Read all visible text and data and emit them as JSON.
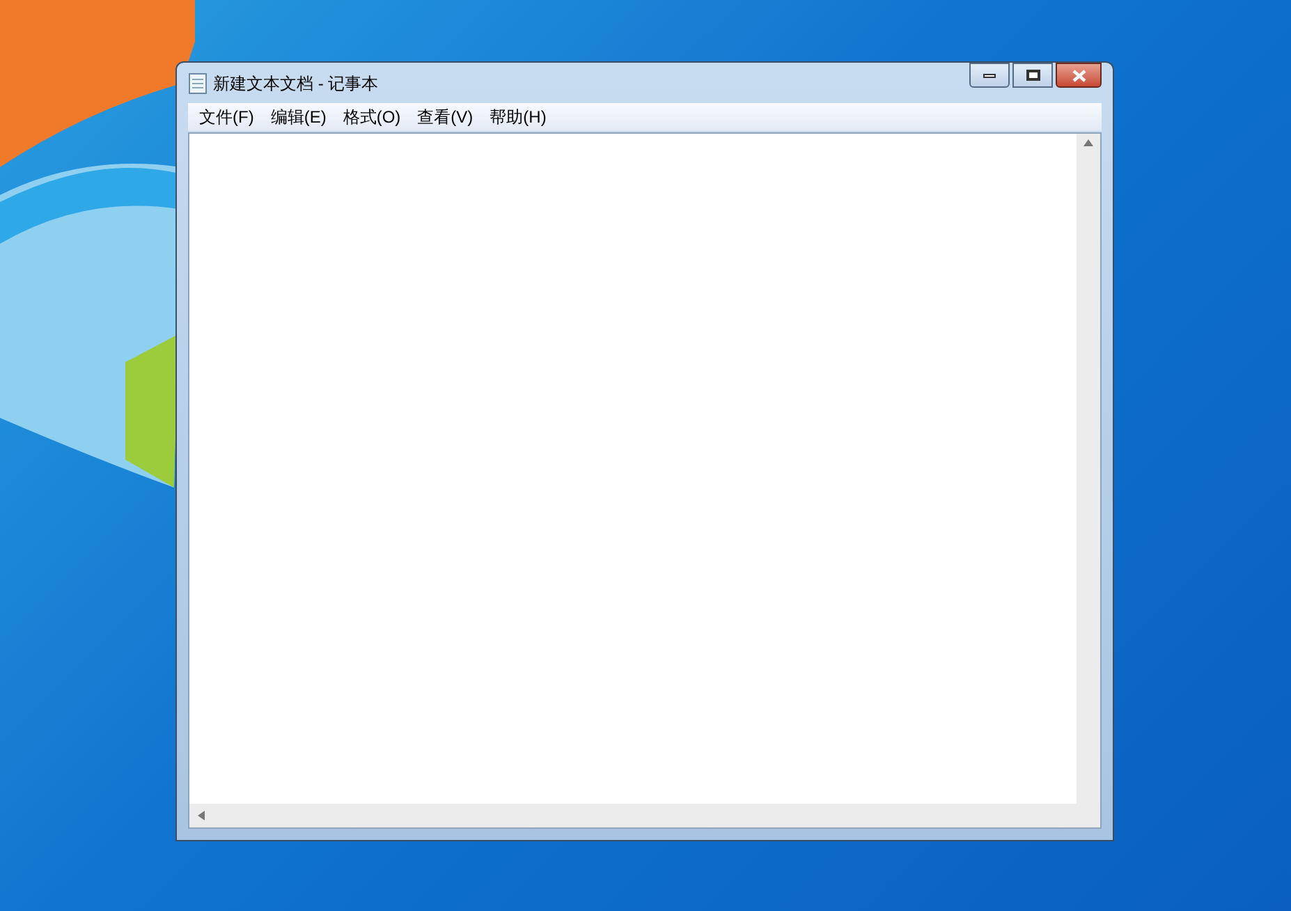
{
  "window": {
    "title": "新建文本文档 - 记事本"
  },
  "menu": [
    "文件(F)",
    "编辑(E)",
    "格式(O)",
    "查看(V)",
    "帮助(H)"
  ]
}
